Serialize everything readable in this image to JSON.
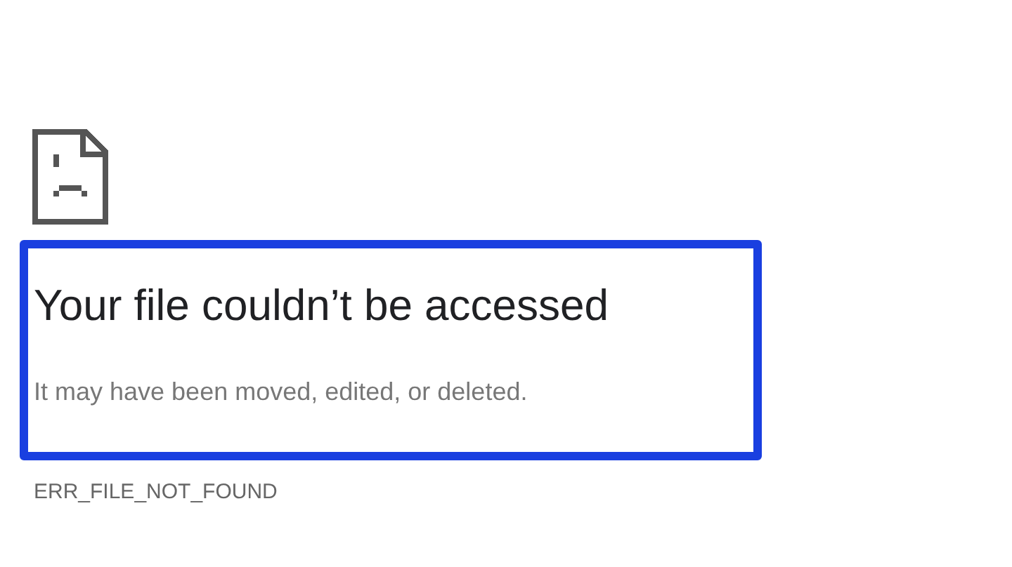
{
  "error_page": {
    "heading": "Your file couldn’t be accessed",
    "message": "It may have been moved, edited, or deleted.",
    "error_code": "ERR_FILE_NOT_FOUND"
  }
}
